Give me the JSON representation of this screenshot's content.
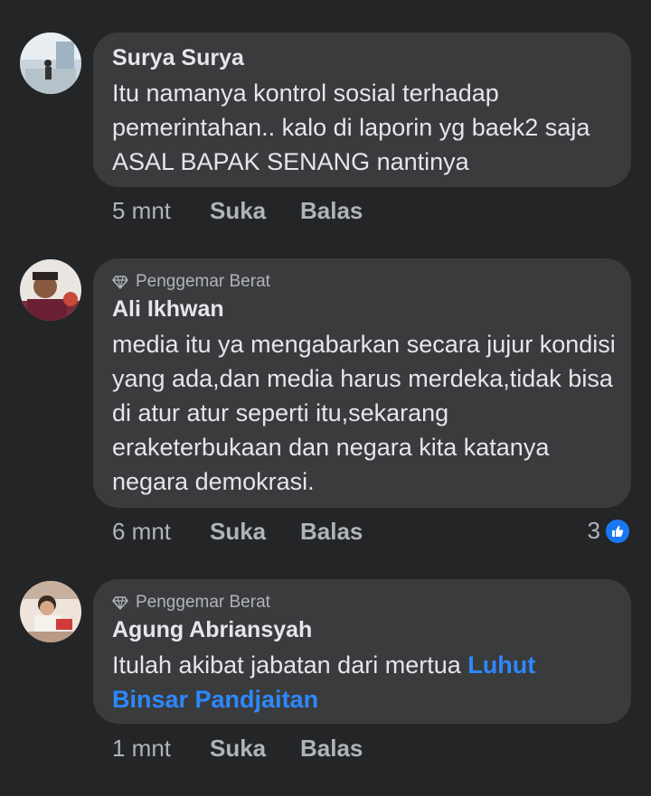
{
  "comments": [
    {
      "author": "Surya Surya",
      "badge": "",
      "text": "Itu namanya kontrol sosial terhadap pemerintahan.. kalo di laporin yg baek2 saja ASAL BAPAK SENANG nantinya",
      "time": "5 mnt",
      "like_label": "Suka",
      "reply_label": "Balas"
    },
    {
      "author": "Ali Ikhwan",
      "badge": "Penggemar Berat",
      "text": "media itu ya mengabarkan secara jujur kondisi yang ada,dan media harus merdeka,tidak bisa di atur atur seperti itu,sekarang eraketerbukaan  dan negara kita katanya negara demokrasi.",
      "time": "6 mnt",
      "like_label": "Suka",
      "reply_label": "Balas",
      "reaction_count": "3",
      "reaction_icon": "thumbs-up-icon"
    },
    {
      "author": "Agung Abriansyah",
      "badge": "Penggemar Berat",
      "text": "Itulah akibat jabatan dari mertua ",
      "mention": "Luhut Binsar Pandjaitan",
      "time": "1 mnt",
      "like_label": "Suka",
      "reply_label": "Balas"
    }
  ],
  "colors": {
    "background": "#242527",
    "bubble": "#3a3b3c",
    "text": "#e4e6eb",
    "muted": "#b0b3b8",
    "mention": "#2d88ff",
    "like_badge": "#1877f2"
  },
  "icons": {
    "badge": "diamond-icon"
  }
}
